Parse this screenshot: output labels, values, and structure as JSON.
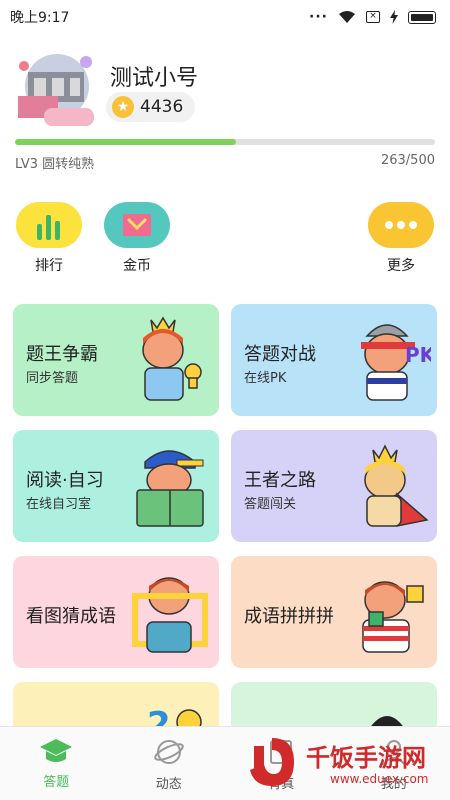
{
  "status_bar": {
    "time": "晚上9:17",
    "dots": "···"
  },
  "profile": {
    "name": "测试小号",
    "coins": "4436",
    "level": "LV3 圆转纯熟",
    "xp": "263/500",
    "progress": 0.526,
    "avatar_icon": "avatar-icon"
  },
  "shortcuts": {
    "rank": {
      "label": "排行",
      "icon": "bar-chart-icon",
      "color": "#fbe23c"
    },
    "coins": {
      "label": "金币",
      "icon": "envelope-icon",
      "color": "#54c8bf"
    },
    "more": {
      "label": "更多",
      "icon": "more-dots-icon",
      "color": "#f9c532"
    }
  },
  "cards": [
    {
      "title": "题王争霸",
      "subtitle": "同步答题",
      "color": "#b6f0c7",
      "icon": "king-trophy-icon"
    },
    {
      "title": "答题对战",
      "subtitle": "在线PK",
      "color": "#b8e2f7",
      "icon": "pk-fighter-icon"
    },
    {
      "title": "阅读·自习",
      "subtitle": "在线自习室",
      "color": "#aef0e0",
      "icon": "reading-book-icon"
    },
    {
      "title": "王者之路",
      "subtitle": "答题闯关",
      "color": "#d6d2f7",
      "icon": "caped-king-icon"
    },
    {
      "title": "看图猜成语",
      "subtitle": "",
      "color": "#fdd6e0",
      "icon": "picture-frame-icon"
    },
    {
      "title": "成语拼拼拼",
      "subtitle": "",
      "color": "#fddcc6",
      "icon": "puzzle-icon"
    }
  ],
  "bottom_nav": [
    {
      "label": "答题",
      "icon": "graduation-cap-icon",
      "active": true
    },
    {
      "label": "动态",
      "icon": "planet-icon",
      "active": false
    },
    {
      "label": "背真",
      "icon": "book-icon",
      "active": false
    },
    {
      "label": "我的",
      "icon": "profile-icon",
      "active": false
    }
  ],
  "watermark": {
    "text": "千饭手游网",
    "url": "www.eduex.com"
  },
  "colors": {
    "accent_green": "#4cbb5a",
    "progress": "#7ed35b",
    "watermark_red": "#d12a2a"
  }
}
